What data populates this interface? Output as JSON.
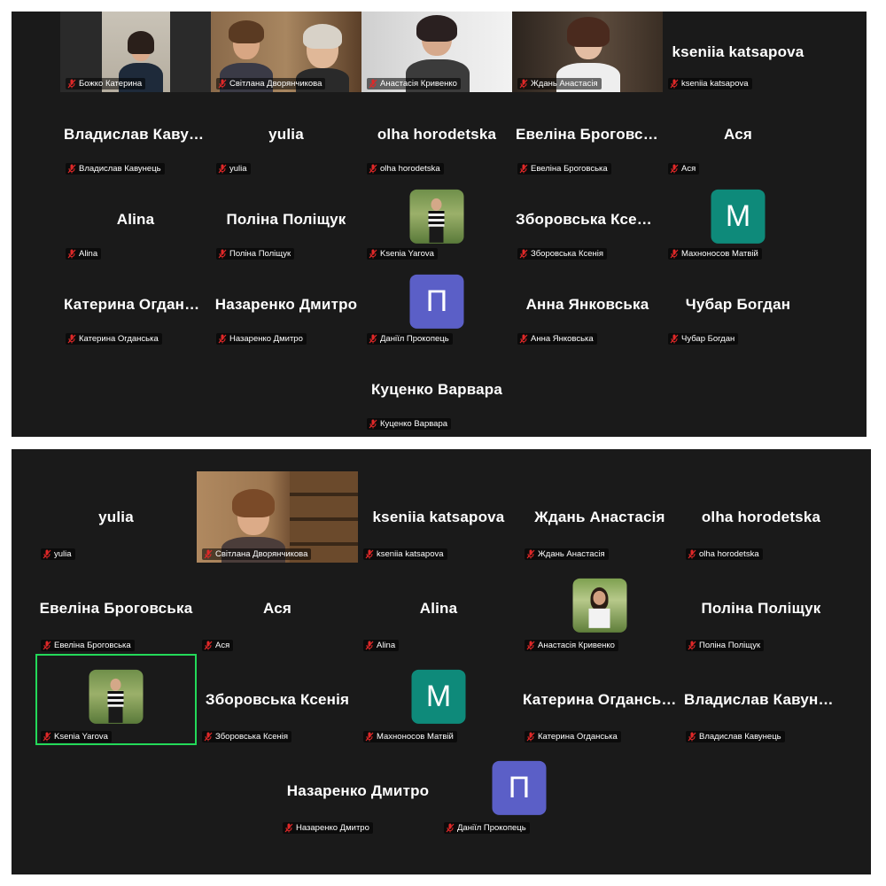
{
  "top": {
    "tiles": [
      {
        "label": "Божко Катерина"
      },
      {
        "label": "Світлана Дворянчикова"
      },
      {
        "label": "Анастасія Кривенко"
      },
      {
        "label": "Ждань Анастасія"
      },
      {
        "name": "kseniia katsapova",
        "label": "kseniia katsapova"
      },
      {
        "name": "Владислав Кавунець",
        "label": "Владислав Кавунець"
      },
      {
        "name": "yulia",
        "label": "yulia"
      },
      {
        "name": "olha horodetska",
        "label": "olha horodetska"
      },
      {
        "name": "Евеліна Броговська",
        "label": "Евеліна Броговська"
      },
      {
        "name": "Ася",
        "label": "Ася"
      },
      {
        "name": "Alina",
        "label": "Alina"
      },
      {
        "name": "Поліна Поліщук",
        "label": "Поліна Поліщук"
      },
      {
        "label": "Ksenia Yarova"
      },
      {
        "name": "Зборовська Ксенія",
        "label": "Зборовська Ксенія"
      },
      {
        "avatar": "М",
        "label": "Махноносов Матвій"
      },
      {
        "name": "Катерина Огданська",
        "label": "Катерина Огданська"
      },
      {
        "name": "Назаренко Дмитро",
        "label": "Назаренко Дмитро"
      },
      {
        "avatar": "П",
        "label": "Даніїл Прокопець"
      },
      {
        "name": "Анна Янковська",
        "label": "Анна Янковська"
      },
      {
        "name": "Чубар Богдан",
        "label": "Чубар Богдан"
      },
      {
        "name": "Куценко Варвара",
        "label": "Куценко Варвара"
      }
    ]
  },
  "bottom": {
    "tiles": [
      {
        "name": "yulia",
        "label": "yulia"
      },
      {
        "label": "Світлана Дворянчикова"
      },
      {
        "name": "kseniia katsapova",
        "label": "kseniia katsapova"
      },
      {
        "name": "Ждань Анастасія",
        "label": "Ждань Анастасія"
      },
      {
        "name": "olha horodetska",
        "label": "olha horodetska"
      },
      {
        "name": "Евеліна Броговська",
        "label": "Евеліна Броговська"
      },
      {
        "name": "Ася",
        "label": "Ася"
      },
      {
        "name": "Alina",
        "label": "Alina"
      },
      {
        "label": "Анастасія Кривенко"
      },
      {
        "name": "Поліна Поліщук",
        "label": "Поліна Поліщук"
      },
      {
        "label": "Ksenia Yarova"
      },
      {
        "name": "Зборовська Ксенія",
        "label": "Зборовська Ксенія"
      },
      {
        "avatar": "М",
        "label": "Махноносов Матвій"
      },
      {
        "name": "Катерина Огданська",
        "label": "Катерина Огданська"
      },
      {
        "name": "Владислав Кавунець",
        "label": "Владислав Кавунець"
      },
      {
        "name": "Назаренко Дмитро",
        "label": "Назаренко Дмитро"
      },
      {
        "avatar": "П",
        "label": "Даніїл Прокопець"
      }
    ]
  },
  "colors": {
    "background": "#1a1a1a",
    "active_speaker_border": "#23d959",
    "avatar_m": "#0e8a7a",
    "avatar_p": "#5b5fc7",
    "mic_muted": "#e02828"
  }
}
